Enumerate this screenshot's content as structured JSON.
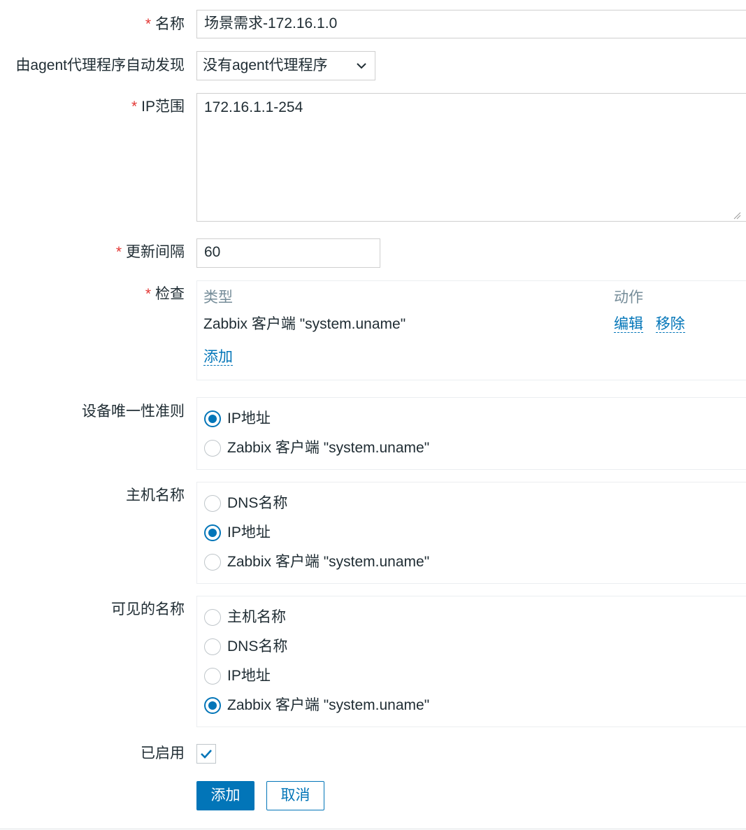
{
  "form": {
    "required_mark": "*",
    "name": {
      "label": "名称",
      "value": "场景需求-172.16.1.0"
    },
    "proxy": {
      "label": "由agent代理程序自动发现",
      "selected": "没有agent代理程序"
    },
    "ip_range": {
      "label": "IP范围",
      "value": "172.16.1.1-254"
    },
    "interval": {
      "label": "更新间隔",
      "value": "60"
    },
    "checks": {
      "label": "检查",
      "col_type": "类型",
      "col_action": "动作",
      "rows": [
        {
          "type": "Zabbix 客户端 \"system.uname\"",
          "edit": "编辑",
          "remove": "移除"
        }
      ],
      "add_link": "添加"
    },
    "uniqueness": {
      "label": "设备唯一性准则",
      "options": [
        "IP地址",
        "Zabbix 客户端 \"system.uname\""
      ],
      "selected_index": 0
    },
    "host_name": {
      "label": "主机名称",
      "options": [
        "DNS名称",
        "IP地址",
        "Zabbix 客户端 \"system.uname\""
      ],
      "selected_index": 1
    },
    "visible_name": {
      "label": "可见的名称",
      "options": [
        "主机名称",
        "DNS名称",
        "IP地址",
        "Zabbix 客户端 \"system.uname\""
      ],
      "selected_index": 3
    },
    "enabled": {
      "label": "已启用",
      "checked": true
    },
    "buttons": {
      "add": "添加",
      "cancel": "取消"
    }
  },
  "colors": {
    "accent": "#0275b8",
    "required": "#e33734",
    "border": "#cfcfcf"
  }
}
